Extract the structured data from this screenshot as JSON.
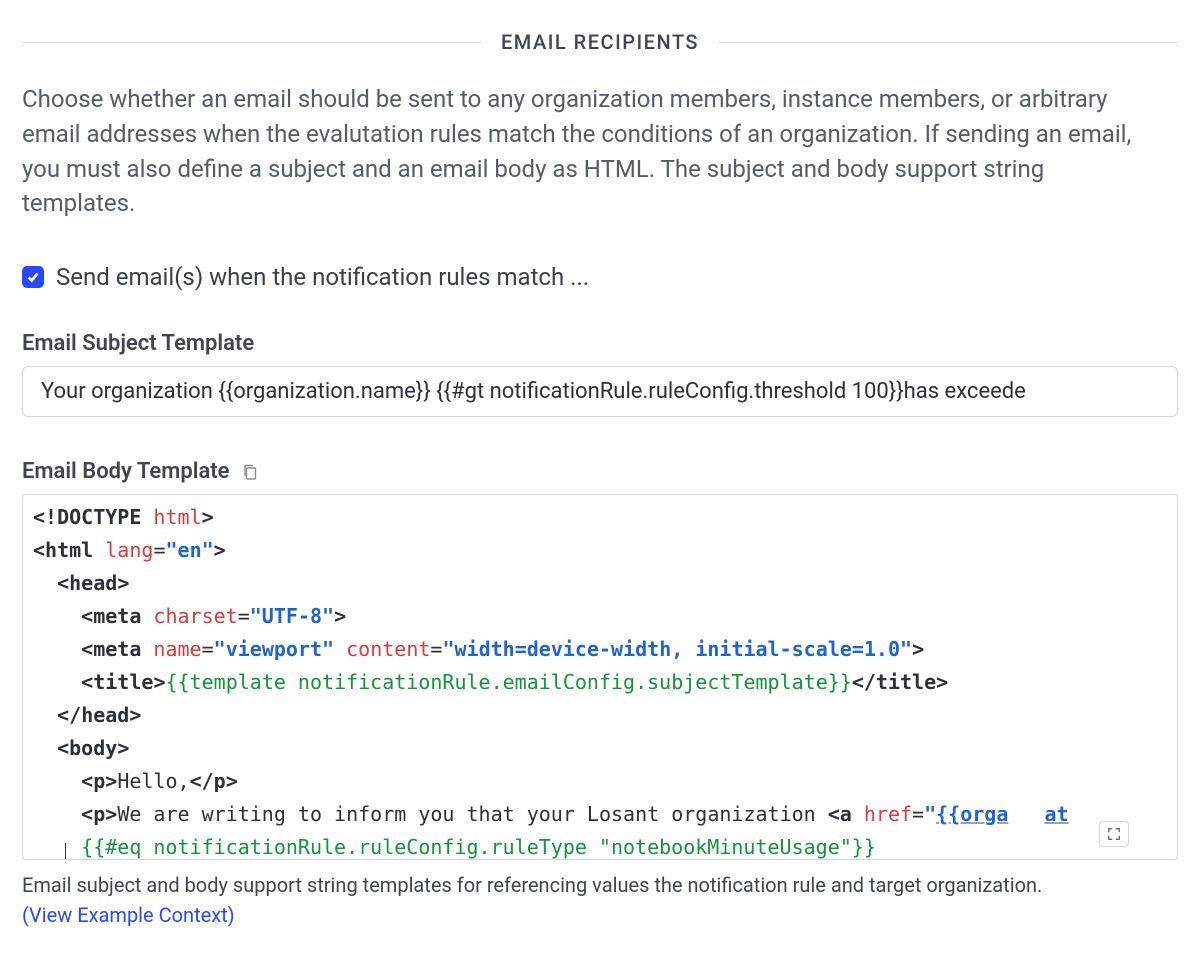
{
  "section": {
    "title": "EMAIL RECIPIENTS",
    "intro": "Choose whether an email should be sent to any organization members, instance members, or arbitrary email addresses when the evalutation rules match the conditions of an organization. If sending an email, you must also define a subject and an email body as HTML. The subject and body support string templates."
  },
  "sendEmail": {
    "checked": true,
    "label": "Send email(s) when the notification rules match ..."
  },
  "subject": {
    "label": "Email Subject Template",
    "value": "Your organization {{organization.name}} {{#gt notificationRule.ruleConfig.threshold 100}}has exceede"
  },
  "body": {
    "label": "Email Body Template",
    "code": {
      "l1_a": "<!",
      "l1_b": "DOCTYPE",
      "l1_c": " html",
      "l1_d": ">",
      "l2_a": "<",
      "l2_b": "html",
      "l2_c": " lang",
      "l2_d": "=",
      "l2_e": "\"en\"",
      "l2_f": ">",
      "l3_a": "<",
      "l3_b": "head",
      "l3_c": ">",
      "l4_a": "<",
      "l4_b": "meta",
      "l4_c": " charset",
      "l4_d": "=",
      "l4_e": "\"UTF-8\"",
      "l4_f": ">",
      "l5_a": "<",
      "l5_b": "meta",
      "l5_c": " name",
      "l5_d": "=",
      "l5_e": "\"viewport\"",
      "l5_f": " content",
      "l5_g": "=",
      "l5_h": "\"width=device-width, initial-scale=1.0\"",
      "l5_i": ">",
      "l6_a": "<",
      "l6_b": "title",
      "l6_c": ">",
      "l6_d": "{{template notificationRule.emailConfig.subjectTemplate}}",
      "l6_e": "</",
      "l6_f": "title",
      "l6_g": ">",
      "l7_a": "</",
      "l7_b": "head",
      "l7_c": ">",
      "l8_a": "<",
      "l8_b": "body",
      "l8_c": ">",
      "l9_a": "<",
      "l9_b": "p",
      "l9_c": ">",
      "l9_d": "Hello,",
      "l9_e": "</",
      "l9_f": "p",
      "l9_g": ">",
      "l10_a": "<",
      "l10_b": "p",
      "l10_c": ">",
      "l10_d": "We are writing to inform you that your Losant organization ",
      "l10_e": "<",
      "l10_f": "a",
      "l10_g": " href",
      "l10_h": "=",
      "l10_i": "\"",
      "l10_j": "{{orga",
      "l10_k": "   ",
      "l10_l": "at",
      "l11_a": "{{#eq notificationRule.ruleConfig.ruleType \"notebookMinuteUsage\"}}"
    }
  },
  "help": {
    "text": "Email subject and body support string templates for referencing values the notification rule and target organization.",
    "link_text": "(View Example Context)"
  }
}
